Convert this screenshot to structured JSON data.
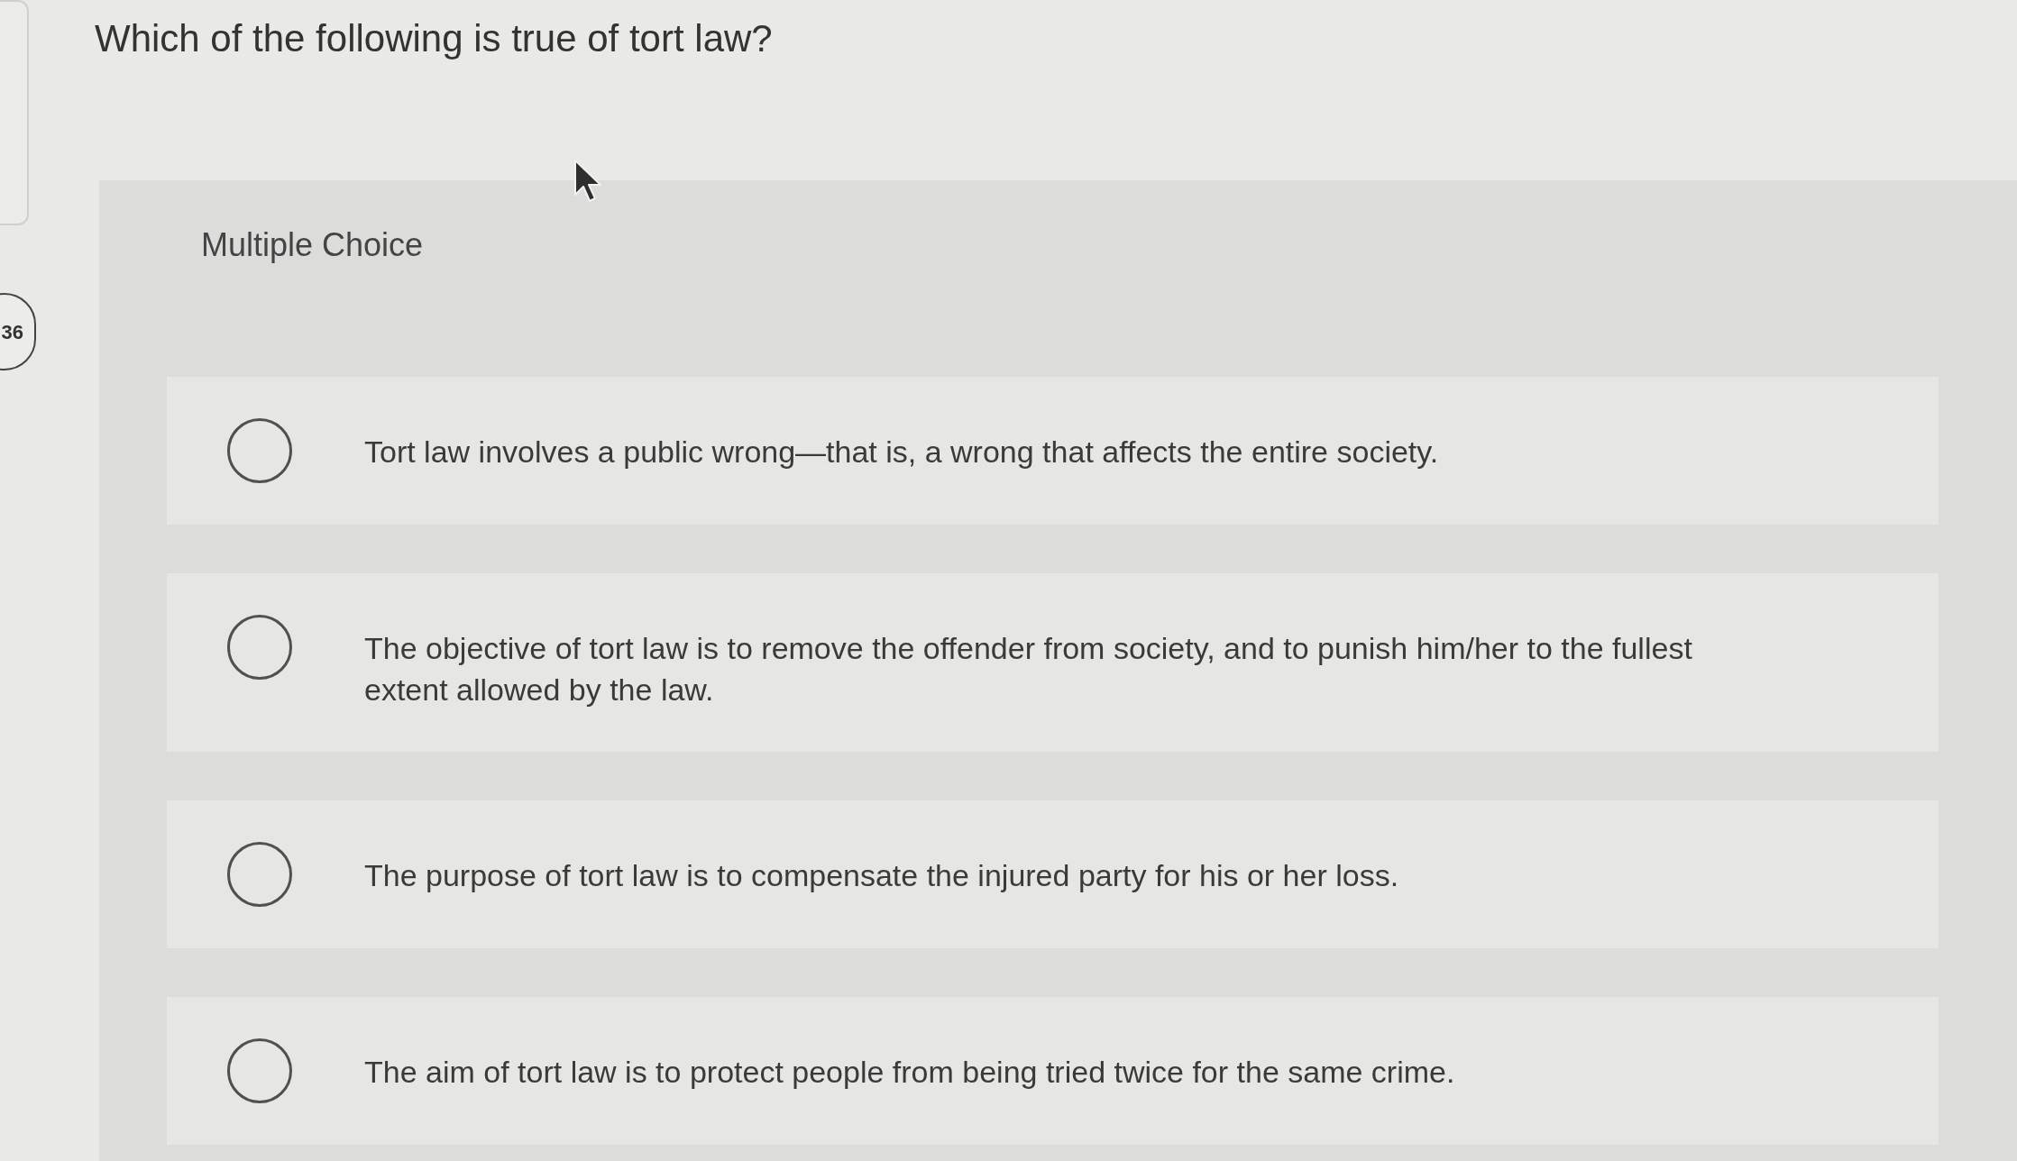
{
  "question_number": "36",
  "question": "Which of the following is true of tort law?",
  "format_label": "Multiple Choice",
  "options": [
    {
      "text": "Tort law involves a public wrong—that is, a wrong that affects the entire society.",
      "selected": false
    },
    {
      "text": "The objective of tort law is to remove the offender from society, and to punish him/her to the fullest extent allowed by the law.",
      "selected": false
    },
    {
      "text": "The purpose of tort law is to compensate the injured party for his or her loss.",
      "selected": false
    },
    {
      "text": "The aim of tort law is to protect people from being tried twice for the same crime.",
      "selected": false
    }
  ]
}
